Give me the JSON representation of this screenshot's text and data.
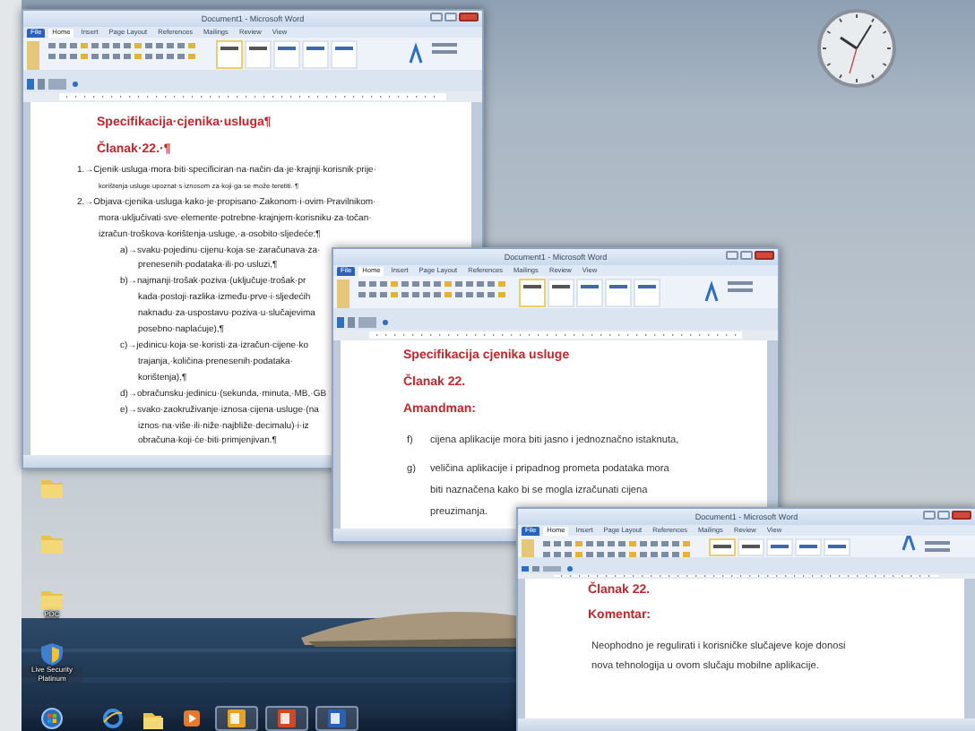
{
  "desktop": {
    "icons": [
      {
        "kind": "folder"
      },
      {
        "kind": "folder"
      },
      {
        "kind": "folder",
        "label": "PDC"
      },
      {
        "kind": "security",
        "label": "Live Security Platinum"
      }
    ]
  },
  "taskbar": {
    "apps": [
      {
        "kind": "start",
        "running": false
      },
      {
        "kind": "browser",
        "running": false
      },
      {
        "kind": "folder",
        "running": false
      },
      {
        "kind": "media",
        "running": false
      },
      {
        "kind": "mail",
        "running": true
      },
      {
        "kind": "slides",
        "running": true
      },
      {
        "kind": "writer",
        "running": true
      }
    ]
  },
  "windows": [
    {
      "title": "Document1 - Microsoft Word",
      "tabs": [
        {
          "label": "File",
          "kind": "file",
          "selected": false
        },
        {
          "label": "Home",
          "kind": "tab",
          "selected": true
        },
        {
          "label": "Insert",
          "kind": "tab",
          "selected": false
        },
        {
          "label": "Page Layout",
          "kind": "tab",
          "selected": false
        },
        {
          "label": "References",
          "kind": "tab",
          "selected": false
        },
        {
          "label": "Mailings",
          "kind": "tab",
          "selected": false
        },
        {
          "label": "Review",
          "kind": "tab",
          "selected": false
        },
        {
          "label": "View",
          "kind": "tab",
          "selected": false
        }
      ],
      "document": [
        {
          "kind": "heading",
          "text": "Specifikacija·cjenika·usluga¶"
        },
        {
          "kind": "heading",
          "text": "Članak·22.·¶"
        },
        {
          "kind": "list",
          "text": "1.→Cjenik·usluga·mora·biti·specificiran·na·način·da·je·krajnji·korisnik·prije·"
        },
        {
          "kind": "small",
          "text": "korištenja·usluge·upoznat·s·iznosom·za·koji·ga·se·može·teretiti.·¶"
        },
        {
          "kind": "list",
          "text": "2.→Objava·cjenika·usluga·kako·je·propisano·Zakonom·i·ovim·Pravilnikom·"
        },
        {
          "kind": "cont",
          "text": "mora·uključivati·sve·elemente·potrebne·krajnjem·korisniku·za·točan·"
        },
        {
          "kind": "cont",
          "text": "izračun·troškova·korištenja·usluge,·a·osobito·sljedeće:¶"
        },
        {
          "kind": "sub",
          "text": "a)→svaku·pojedinu·cijenu·koja·se·zaračunava·za·"
        },
        {
          "kind": "subcont",
          "text": "prenesenih·podataka·ili·po·usluzi,¶"
        },
        {
          "kind": "sub",
          "text": "b)→najmanji·trošak·poziva·(uključuje·trošak·pr"
        },
        {
          "kind": "subcont",
          "text": "kada·postoji·razlika·između·prve·i·sljedećih"
        },
        {
          "kind": "subcont",
          "text": "naknadu·za·uspostavu·poziva·u·slučajevima"
        },
        {
          "kind": "subcont",
          "text": "posebno·naplaćuje),¶"
        },
        {
          "kind": "sub",
          "text": "c)→jedinicu·koja·se·koristi·za·izračun·cijene·ko"
        },
        {
          "kind": "subcont",
          "text": "trajanja,·količina·prenesenih·podataka·"
        },
        {
          "kind": "subcont",
          "text": "korištenja),¶"
        },
        {
          "kind": "sub",
          "text": "d)→obračunsku·jedinicu·(sekunda,·minuta,·MB,·GB"
        },
        {
          "kind": "sub",
          "text": "e)→svako·zaokruživanje·iznosa·cijena·usluge·(na"
        },
        {
          "kind": "subcont",
          "text": "iznos·na·više·ili·niže·najbliže·decimalu)·i·iz"
        },
        {
          "kind": "subcont",
          "text": "obračuna·koji·će·biti·primjenjivan.¶"
        }
      ]
    },
    {
      "title": "Document1 - Microsoft Word",
      "tabs": [
        {
          "label": "File",
          "kind": "file",
          "selected": false
        },
        {
          "label": "Home",
          "kind": "tab",
          "selected": true
        },
        {
          "label": "Insert",
          "kind": "tab",
          "selected": false
        },
        {
          "label": "Page Layout",
          "kind": "tab",
          "selected": false
        },
        {
          "label": "References",
          "kind": "tab",
          "selected": false
        },
        {
          "label": "Mailings",
          "kind": "tab",
          "selected": false
        },
        {
          "label": "Review",
          "kind": "tab",
          "selected": false
        },
        {
          "label": "View",
          "kind": "tab",
          "selected": false
        }
      ],
      "document": [
        {
          "kind": "heading",
          "text": "Specifikacija cjenika usluge"
        },
        {
          "kind": "heading",
          "text": "Članak 22."
        },
        {
          "kind": "heading",
          "text": "Amandman:"
        },
        {
          "kind": "item",
          "marker": "f)",
          "lines": [
            "cijena aplikacije mora biti jasno i jednoznačno istaknuta,"
          ]
        },
        {
          "kind": "item",
          "marker": "g)",
          "lines": [
            "veličina aplikacije i pripadnog prometa podataka mora",
            "biti naznačena kako bi se mogla izračunati cijena",
            "preuzimanja."
          ]
        }
      ]
    },
    {
      "title": "Document1 - Microsoft Word",
      "tabs": [
        {
          "label": "File",
          "kind": "file",
          "selected": false
        },
        {
          "label": "Home",
          "kind": "tab",
          "selected": true
        },
        {
          "label": "Insert",
          "kind": "tab",
          "selected": false
        },
        {
          "label": "Page Layout",
          "kind": "tab",
          "selected": false
        },
        {
          "label": "References",
          "kind": "tab",
          "selected": false
        },
        {
          "label": "Mailings",
          "kind": "tab",
          "selected": false
        },
        {
          "label": "Review",
          "kind": "tab",
          "selected": false
        },
        {
          "label": "View",
          "kind": "tab",
          "selected": false
        }
      ],
      "document": [
        {
          "kind": "heading",
          "text": "Članak 22."
        },
        {
          "kind": "heading",
          "text": "Komentar:"
        },
        {
          "kind": "para",
          "lines": [
            "Neophodno je regulirati i korisničke slučajeve koje donosi",
            "nova tehnologija u ovom slučaju mobilne aplikacije."
          ]
        }
      ]
    }
  ]
}
